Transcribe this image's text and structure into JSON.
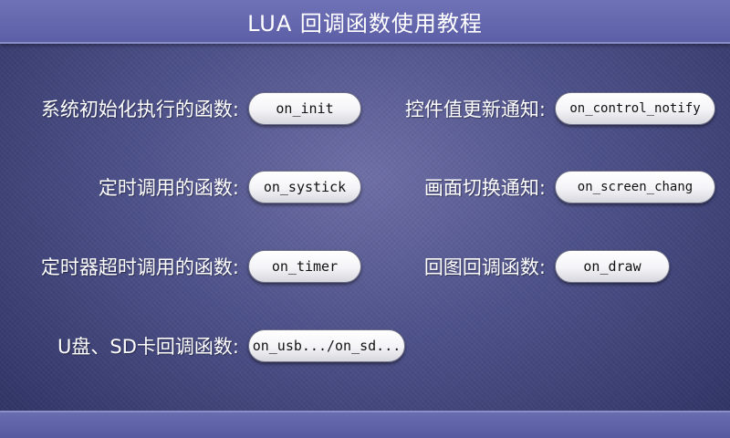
{
  "header": {
    "title": "LUA 回调函数使用教程"
  },
  "items": {
    "init": {
      "label": "系统初始化执行的函数:",
      "button": "on_init"
    },
    "control_notify": {
      "label": "控件值更新通知:",
      "button": "on_control_notify"
    },
    "systick": {
      "label": "定时调用的函数:",
      "button": "on_systick"
    },
    "screen_change": {
      "label": "画面切换通知:",
      "button": "on_screen_chang"
    },
    "timer": {
      "label": "定时器超时调用的函数:",
      "button": "on_timer"
    },
    "draw": {
      "label": "回图回调函数:",
      "button": "on_draw"
    },
    "usb_sd": {
      "label": "U盘、SD卡回调函数:",
      "button": "on_usb.../on_sd..."
    }
  }
}
